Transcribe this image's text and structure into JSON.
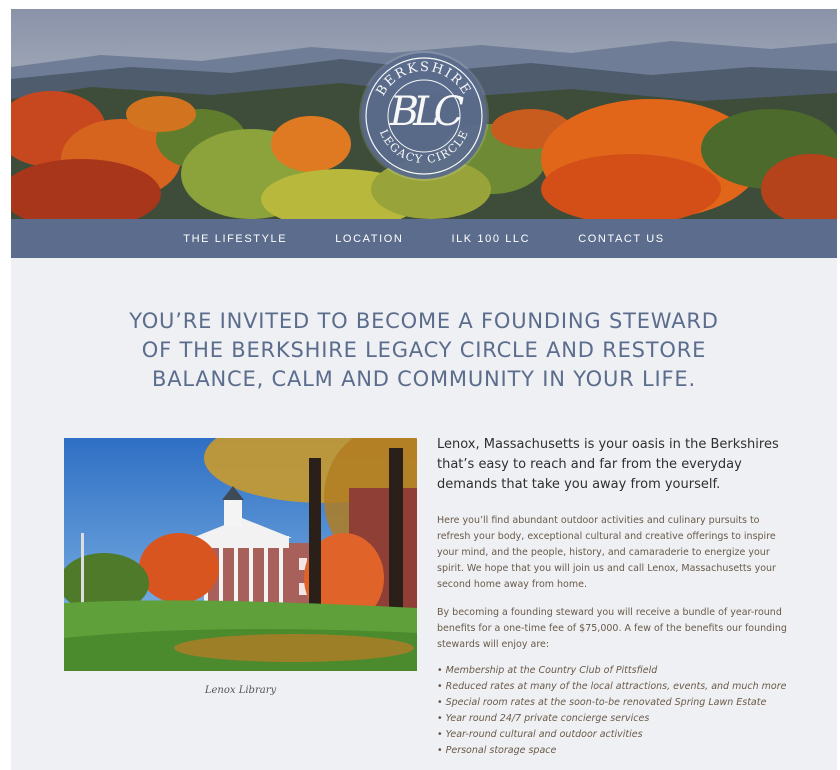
{
  "logo": {
    "top_text": "BERKSHIRE",
    "bottom_text": "LEGACY CIRCLE",
    "monogram": "BLC"
  },
  "nav": {
    "items": [
      "THE LIFESTYLE",
      "LOCATION",
      "ILK 100 LLC",
      "CONTACT US"
    ]
  },
  "headline": {
    "line1": "YOU’RE INVITED TO BECOME A FOUNDING STEWARD",
    "line2": "OF THE BERKSHIRE LEGACY CIRCLE AND RESTORE",
    "line3": "BALANCE, CALM AND COMMUNITY IN YOUR LIFE."
  },
  "photo": {
    "caption": "Lenox Library"
  },
  "content": {
    "lead": "Lenox, Massachusetts is your oasis in the Berkshires that’s easy to reach and far from the everyday demands that take you away from yourself.",
    "paragraph1": "Here you’ll find abundant outdoor activities and culinary pursuits to refresh your body, exceptional cultural and creative offerings to inspire your mind, and the people, history, and camaraderie to energize your spirit. We hope that you will join us and call Lenox, Massachusetts your second home away from home.",
    "paragraph2": "By becoming a founding steward you will receive a bundle of year-round benefits for a one-time fee of $75,000. A few of the benefits our founding stewards will enjoy are:",
    "benefits": [
      "Membership at the Country Club of Pittsfield",
      "Reduced rates at many of the local attractions, events, and much more",
      "Special room rates at the soon-to-be renovated Spring Lawn Estate",
      "Year round 24/7 private concierge services",
      "Year-round cultural and outdoor activities",
      "Personal storage space"
    ]
  },
  "colors": {
    "brand_slate": "#5b6c8d",
    "page_bg": "#eef0f3",
    "body_text": "#6a5a4a"
  }
}
